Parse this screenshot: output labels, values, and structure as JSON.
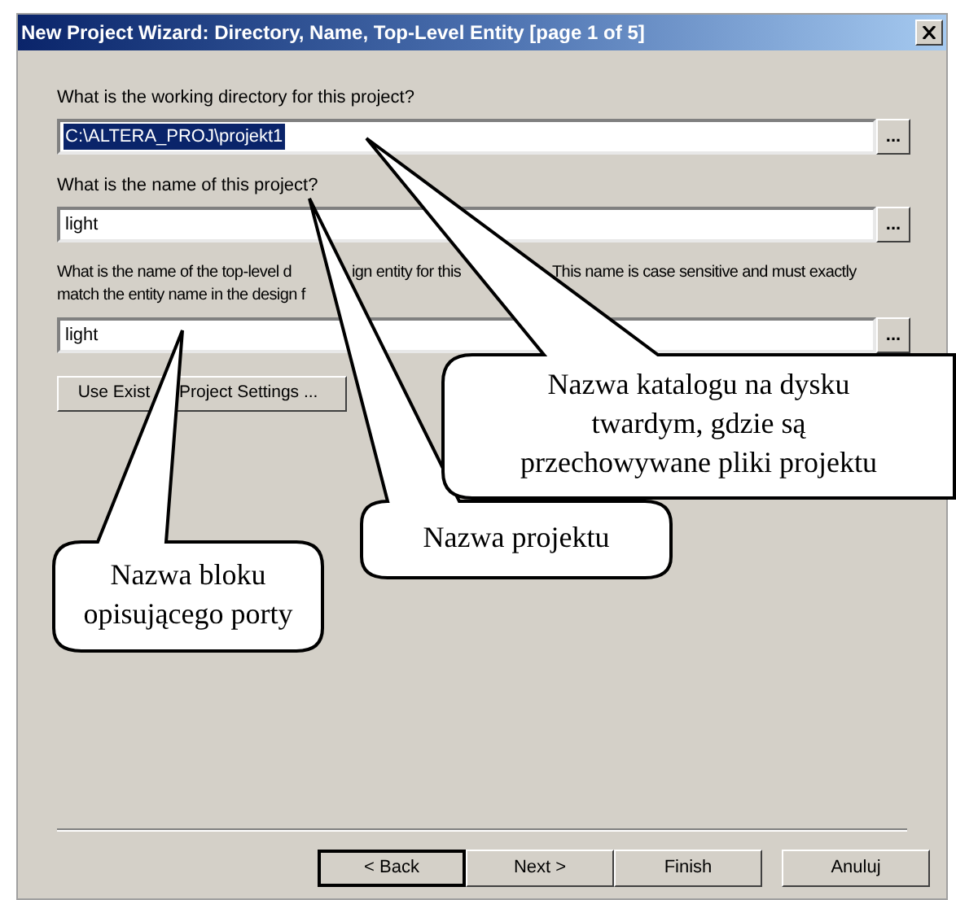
{
  "window": {
    "title": "New Project Wizard: Directory, Name, Top-Level Entity [page 1 of 5]"
  },
  "fields": [
    {
      "label_parts": [
        "What is the working directory for this project?"
      ],
      "value": "C:\\ALTERA_PROJ\\projekt1",
      "text_selected": true,
      "browse": "..."
    },
    {
      "label_parts": [
        "What is the name of this project?"
      ],
      "value": "light",
      "text_selected": false,
      "browse": "..."
    },
    {
      "label_parts": [
        "What is the name of the top-level d",
        "ign entity for this",
        "This name is case sensitive and must exactly",
        "match the entity name in the design f"
      ],
      "value": "light",
      "text_selected": false,
      "browse": "..."
    }
  ],
  "settings_button": {
    "parts": [
      "Use Exist",
      "Project Settings ..."
    ]
  },
  "buttons": [
    {
      "label": "< Back"
    },
    {
      "label": "Next >"
    },
    {
      "label": "Finish"
    },
    {
      "label": "Anuluj"
    }
  ],
  "callouts": [
    {
      "lines": [
        "Nazwa katalogu na dysku",
        "twardym, gdzie są",
        "przechowywane pliki projektu"
      ]
    },
    {
      "lines": [
        "Nazwa projektu"
      ]
    },
    {
      "lines": [
        "Nazwa bloku",
        "opisującego porty"
      ]
    }
  ]
}
